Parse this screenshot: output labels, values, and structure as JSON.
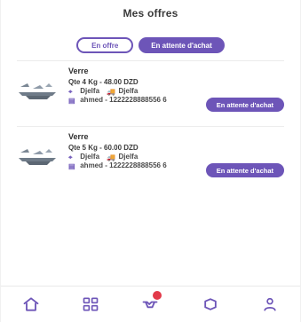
{
  "header": {
    "title": "Mes offres"
  },
  "tabs": {
    "in_progress": "En offre",
    "awaiting": "En attente d'achat"
  },
  "orders": [
    {
      "title": "Verre",
      "qty": "Qte 4 Kg - 48.00 DZD",
      "location_from": "Djelfa",
      "location_to": "Djelfa",
      "contact": "ahmed - 1222228888556 6",
      "status": "En attente d'achat"
    },
    {
      "title": "Verre",
      "qty": "Qte 5 Kg - 60.00 DZD",
      "location_from": "Djelfa",
      "location_to": "Djelfa",
      "contact": "ahmed - 1222228888556 6",
      "status": "En attente d'achat"
    }
  ],
  "bottom_nav": [
    {
      "name": "home-icon"
    },
    {
      "name": "grid-icon"
    },
    {
      "name": "handshake-icon"
    },
    {
      "name": "tag-icon"
    },
    {
      "name": "profile-icon"
    }
  ],
  "colors": {
    "accent": "#6d55b8",
    "badge": "#e23a4a"
  }
}
